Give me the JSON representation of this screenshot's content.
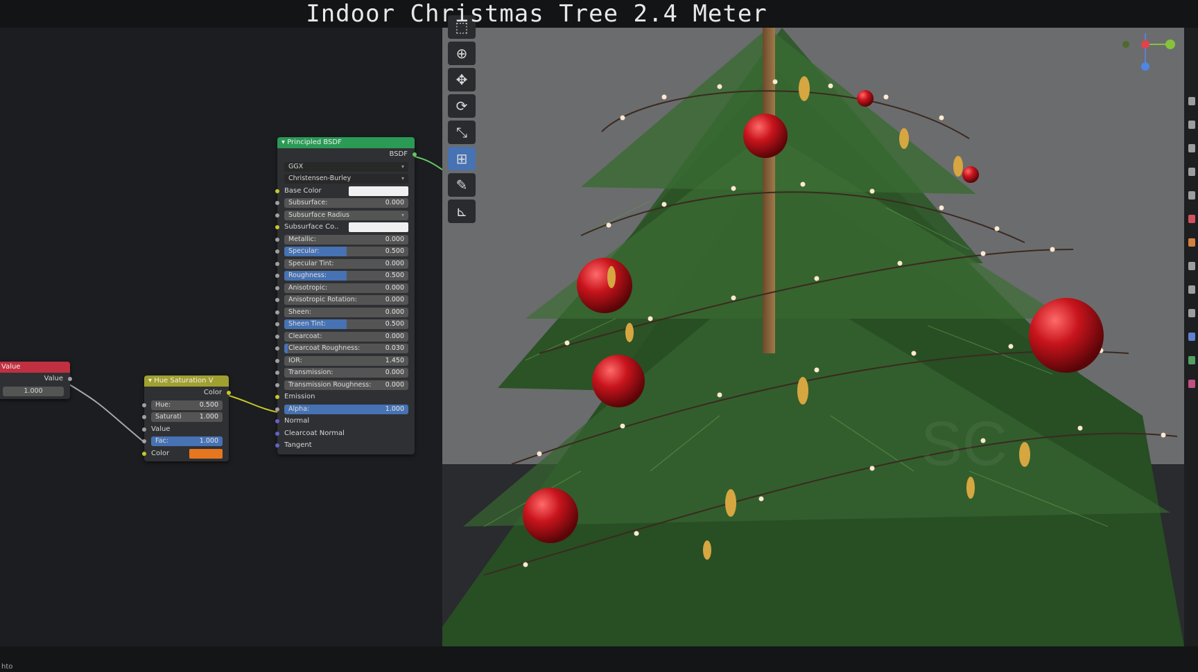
{
  "title": "Indoor Christmas Tree 2.4 Meter",
  "status_text": "hto",
  "colors": {
    "value_header": "#c03040",
    "hue_header": "#a0a030",
    "bsdf_header": "#2a9a55",
    "accent_blue": "#4772b3",
    "orange": "#e6761f"
  },
  "value_node": {
    "title": "Value",
    "output": "Value",
    "value": "1.000"
  },
  "hue_node": {
    "title": "Hue Saturation V",
    "output": "Color",
    "hue_label": "Hue:",
    "hue_value": "0.500",
    "sat_label": "Saturati",
    "sat_value": "1.000",
    "value_label": "Value",
    "fac_label": "Fac:",
    "fac_value": "1.000",
    "fac_fill": 1.0,
    "color_label": "Color"
  },
  "bsdf_node": {
    "title": "Principled BSDF",
    "output": "BSDF",
    "distribution": "GGX",
    "subsurface_method": "Christensen-Burley",
    "fields": [
      {
        "label": "Base Color",
        "type": "color",
        "color": "#f0f0f0"
      },
      {
        "label": "Subsurface:",
        "type": "value",
        "value": "0.000",
        "fill": 0
      },
      {
        "label": "Subsurface Radius",
        "type": "dropdown"
      },
      {
        "label": "Subsurface Co..",
        "type": "color",
        "color": "#f0f0f0"
      },
      {
        "label": "Metallic:",
        "type": "value",
        "value": "0.000",
        "fill": 0
      },
      {
        "label": "Specular:",
        "type": "value",
        "value": "0.500",
        "fill": 0.5
      },
      {
        "label": "Specular Tint:",
        "type": "value",
        "value": "0.000",
        "fill": 0
      },
      {
        "label": "Roughness:",
        "type": "value",
        "value": "0.500",
        "fill": 0.5
      },
      {
        "label": "Anisotropic:",
        "type": "value",
        "value": "0.000",
        "fill": 0
      },
      {
        "label": "Anisotropic Rotation:",
        "type": "value",
        "value": "0.000",
        "fill": 0
      },
      {
        "label": "Sheen:",
        "type": "value",
        "value": "0.000",
        "fill": 0
      },
      {
        "label": "Sheen Tint:",
        "type": "value",
        "value": "0.500",
        "fill": 0.5
      },
      {
        "label": "Clearcoat:",
        "type": "value",
        "value": "0.000",
        "fill": 0
      },
      {
        "label": "Clearcoat Roughness:",
        "type": "value",
        "value": "0.030",
        "fill": 0.03
      },
      {
        "label": "IOR:",
        "type": "value",
        "value": "1.450",
        "fill": 0
      },
      {
        "label": "Transmission:",
        "type": "value",
        "value": "0.000",
        "fill": 0
      },
      {
        "label": "Transmission Roughness:",
        "type": "value",
        "value": "0.000",
        "fill": 0
      },
      {
        "label": "Emission",
        "type": "plain"
      },
      {
        "label": "Alpha:",
        "type": "value",
        "value": "1.000",
        "fill": 1.0
      },
      {
        "label": "Normal",
        "type": "plain"
      },
      {
        "label": "Clearcoat Normal",
        "type": "plain"
      },
      {
        "label": "Tangent",
        "type": "plain"
      }
    ]
  },
  "toolbar": [
    {
      "icon": "select-box-icon"
    },
    {
      "icon": "cursor-icon"
    },
    {
      "icon": "move-icon"
    },
    {
      "icon": "rotate-icon"
    },
    {
      "icon": "scale-icon"
    },
    {
      "icon": "transform-icon",
      "active": true
    },
    {
      "icon": "annotate-icon"
    },
    {
      "icon": "measure-icon"
    }
  ]
}
